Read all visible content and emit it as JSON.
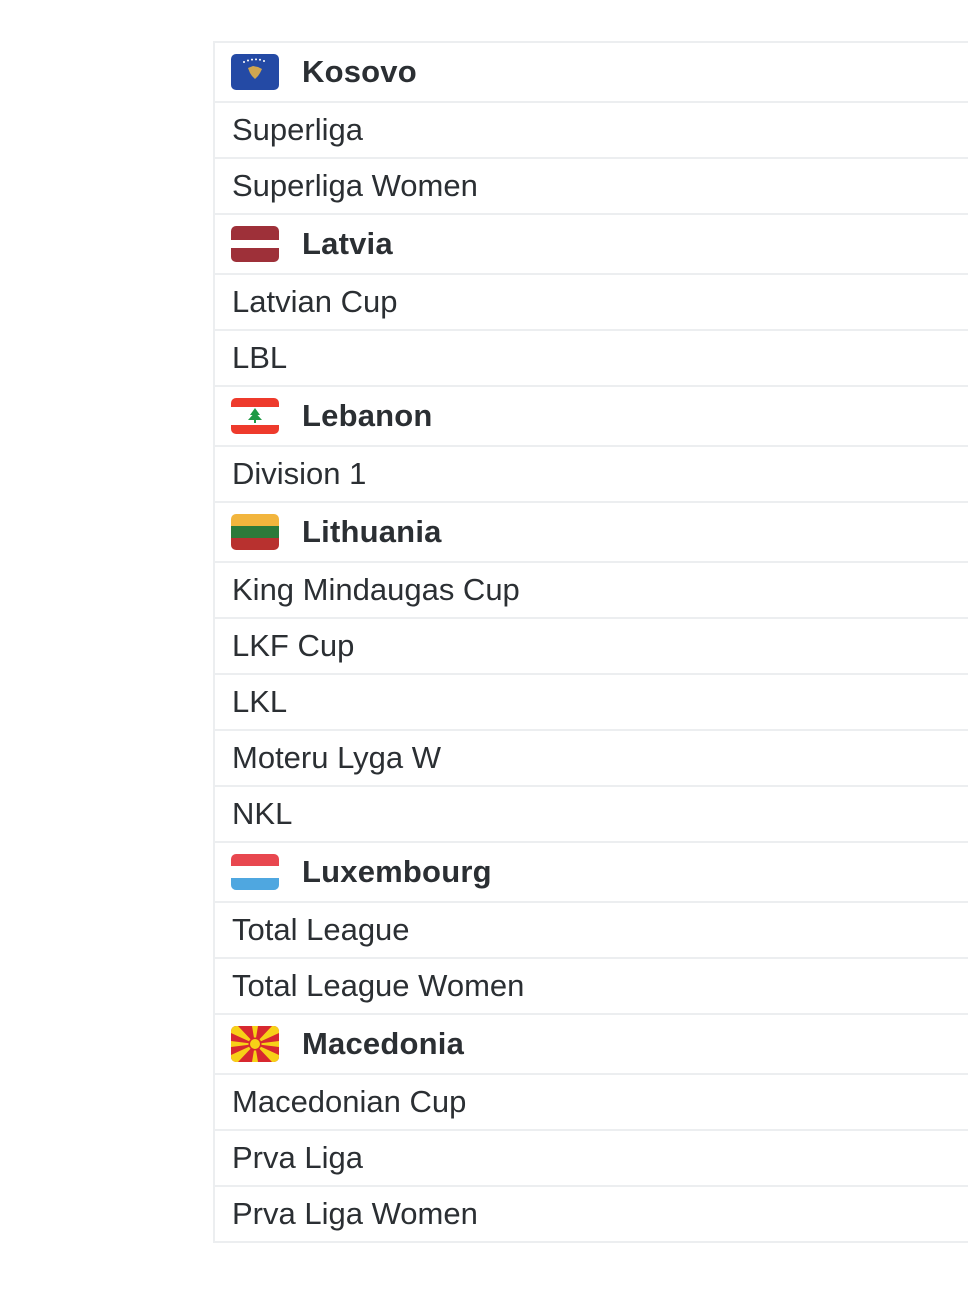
{
  "countries": [
    {
      "name": "Kosovo",
      "flag_icon": "kosovo-flag-icon",
      "leagues": [
        "Superliga",
        "Superliga Women"
      ]
    },
    {
      "name": "Latvia",
      "flag_icon": "latvia-flag-icon",
      "leagues": [
        "Latvian Cup",
        "LBL"
      ]
    },
    {
      "name": "Lebanon",
      "flag_icon": "lebanon-flag-icon",
      "leagues": [
        "Division 1"
      ]
    },
    {
      "name": "Lithuania",
      "flag_icon": "lithuania-flag-icon",
      "leagues": [
        "King Mindaugas Cup",
        "LKF Cup",
        "LKL",
        "Moteru Lyga W",
        "NKL"
      ]
    },
    {
      "name": "Luxembourg",
      "flag_icon": "luxembourg-flag-icon",
      "leagues": [
        "Total League",
        "Total League Women"
      ]
    },
    {
      "name": "Macedonia",
      "flag_icon": "macedonia-flag-icon",
      "leagues": [
        "Macedonian Cup",
        "Prva Liga",
        "Prva Liga Women"
      ]
    }
  ],
  "colors": {
    "text": "#2b2f33",
    "divider": "#eceef0",
    "background": "#ffffff"
  }
}
